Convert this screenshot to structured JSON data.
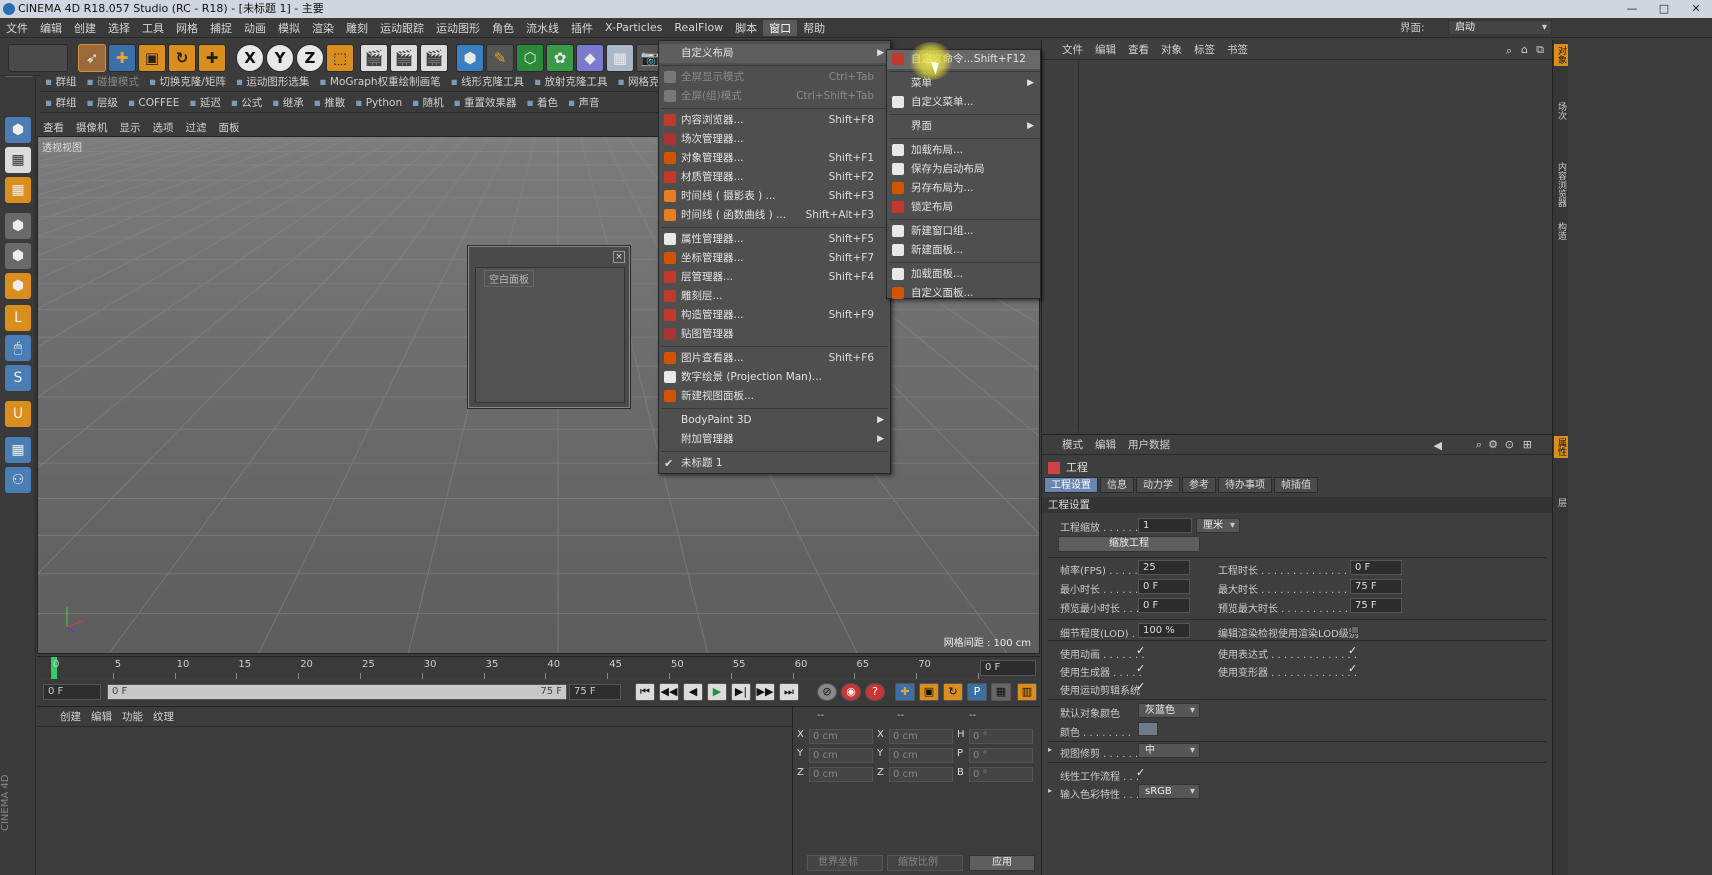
{
  "window": {
    "title": "CINEMA 4D R18.057 Studio (RC - R18) - [未标题 1] - 主要",
    "min": "—",
    "max": "□",
    "close": "✕"
  },
  "menubar": [
    "文件",
    "编辑",
    "创建",
    "选择",
    "工具",
    "网格",
    "捕捉",
    "动画",
    "模拟",
    "渲染",
    "雕刻",
    "运动跟踪",
    "运动图形",
    "角色",
    "流水线",
    "插件",
    "X-Particles",
    "RealFlow",
    "脚本",
    "窗口",
    "帮助"
  ],
  "menubar_active": "窗口",
  "layout": {
    "label": "界面:",
    "value": "启动"
  },
  "toolbar": {
    "x": "X",
    "y": "Y",
    "z": "Z"
  },
  "subbar1": [
    "群组",
    "切换克隆/矩阵",
    "运动图形选集",
    "MoGraph权重绘制画笔",
    "线形克隆工具",
    "放射克隆工具",
    "网格克隆"
  ],
  "subbar1_dim": "碰撞模式",
  "subbar2": [
    "群组",
    "层级",
    "COFFEE",
    "延迟",
    "公式",
    "继承",
    "推散",
    "Python",
    "随机",
    "重置效果器",
    "着色",
    "声音"
  ],
  "viewport": {
    "menu": [
      "查看",
      "摄像机",
      "显示",
      "选项",
      "过滤",
      "面板"
    ],
    "label": "透视视图",
    "grid": "网格间距 : 100 cm"
  },
  "floatwin": {
    "tab": "空白面板",
    "close": "×"
  },
  "timeline": {
    "ticks": [
      "0",
      "5",
      "10",
      "15",
      "20",
      "25",
      "30",
      "35",
      "40",
      "45",
      "50",
      "55",
      "60",
      "65",
      "70",
      "75"
    ],
    "frame": "0 F"
  },
  "transport": {
    "start": "0 F",
    "slider_left": "0 F",
    "slider_right": "75 F",
    "end": "75 F",
    "buttons": [
      "⏮",
      "◀◀",
      "◀",
      "▶",
      "▶|",
      "▶▶",
      "⏭"
    ]
  },
  "material": {
    "menu": [
      "创建",
      "编辑",
      "功能",
      "纹理"
    ]
  },
  "coord": {
    "headers": [
      "--",
      "--",
      "--"
    ],
    "rows": [
      {
        "a": "X",
        "av": "0 cm",
        "b": "X",
        "bv": "0 cm",
        "c": "H",
        "cv": "0 °"
      },
      {
        "a": "Y",
        "av": "0 cm",
        "b": "Y",
        "bv": "0 cm",
        "c": "P",
        "cv": "0 °"
      },
      {
        "a": "Z",
        "av": "0 cm",
        "b": "Z",
        "bv": "0 cm",
        "c": "B",
        "cv": "0 °"
      }
    ],
    "mode1": "世界坐标",
    "mode2": "缩放比例",
    "apply": "应用"
  },
  "objmgr": {
    "menu": [
      "文件",
      "编辑",
      "查看",
      "对象",
      "标签",
      "书签"
    ]
  },
  "attr": {
    "menu": [
      "模式",
      "编辑",
      "用户数据"
    ],
    "title": "工程",
    "tabs": [
      "工程设置",
      "信息",
      "动力学",
      "参考",
      "待办事项",
      "帧插值"
    ],
    "section": "工程设置",
    "scale_label": "工程缩放 . . . . . .",
    "scale_value": "1",
    "scale_unit": "厘米",
    "scale_button": "缩放工程",
    "fps_label": "帧率(FPS) . . . . . .",
    "fps_value": "25",
    "min_label": "最小时长 . . . . . . .",
    "min_value": "0 F",
    "prevmin_label": "预览最小时长 . . .",
    "prevmin_value": "0 F",
    "dur_label": "工程时长 . . . . . . . . . . . . . . . .",
    "dur_value": "0 F",
    "max_label": "最大时长 . . . . . . . . . . . . . . . .",
    "max_value": "75 F",
    "prevmax_label": "预览最大时长 . . . . . . . . . . . .",
    "prevmax_value": "75 F",
    "lod_label": "细节程度(LOD) . . .",
    "lod_value": "100 %",
    "lod_check_label": "编辑渲染检视使用渲染LOD级别",
    "anim_label": "使用动画 . . . . . . .",
    "gen_label": "使用生成器 . . . . .",
    "motion_label": "使用运动剪辑系统",
    "expr_label": "使用表达式 . . . . . . . . . . . . . .",
    "deform_label": "使用变形器 . . . . . . . . . . . . . .",
    "check": "✓",
    "defcolor_label": "默认对象颜色",
    "defcolor_value": "灰蓝色",
    "color_label": "颜色 . . . . . . . .",
    "clip_label": "视图修剪 . . . . . . .",
    "clip_value": "中",
    "linear_label": "线性工作流程 . . .",
    "input_label": "输入色彩特性 . . .",
    "input_value": "sRGB"
  },
  "right_tabs": [
    "对象",
    "场次",
    "内容浏览器",
    "构造",
    "属性",
    "层"
  ],
  "window_menu": {
    "items": [
      {
        "label": "自定义布局",
        "sc": "",
        "arrow": true,
        "hl": true,
        "dim": false,
        "icon": ""
      },
      {
        "label": "全屏显示模式",
        "sc": "Ctrl+Tab",
        "dim": true,
        "icon": "#777"
      },
      {
        "label": "全屏(组)模式",
        "sc": "Ctrl+Shift+Tab",
        "dim": true,
        "icon": "#777"
      },
      {
        "label": "内容浏览器...",
        "sc": "Shift+F8",
        "icon": "#c0392b"
      },
      {
        "label": "场次管理器...",
        "sc": "",
        "icon": "#a33"
      },
      {
        "label": "对象管理器...",
        "sc": "Shift+F1",
        "icon": "#d35400"
      },
      {
        "label": "材质管理器...",
        "sc": "Shift+F2",
        "icon": "#c0392b"
      },
      {
        "label": "时间线 ( 摄影表 ) ...",
        "sc": "Shift+F3",
        "icon": "#e67e22"
      },
      {
        "label": "时间线 ( 函数曲线 ) ...",
        "sc": "Shift+Alt+F3",
        "icon": "#e67e22"
      },
      {
        "label": "属性管理器...",
        "sc": "Shift+F5",
        "icon": "#e8e8e8"
      },
      {
        "label": "坐标管理器...",
        "sc": "Shift+F7",
        "icon": "#d35400"
      },
      {
        "label": "层管理器...",
        "sc": "Shift+F4",
        "icon": "#c0392b"
      },
      {
        "label": "雕刻层...",
        "sc": "",
        "icon": "#c0392b"
      },
      {
        "label": "构造管理器...",
        "sc": "Shift+F9",
        "icon": "#c0392b"
      },
      {
        "label": "贴图管理器",
        "sc": "",
        "icon": "#a33"
      },
      {
        "label": "图片查看器...",
        "sc": "Shift+F6",
        "icon": "#d35400"
      },
      {
        "label": "数字绘景 (Projection Man)...",
        "sc": "",
        "icon": "#e8e8e8"
      },
      {
        "label": "新建视图面板...",
        "sc": "",
        "icon": "#d35400"
      },
      {
        "label": "BodyPaint 3D",
        "sc": "",
        "arrow": true,
        "icon": ""
      },
      {
        "label": "附加管理器",
        "sc": "",
        "arrow": true,
        "icon": ""
      },
      {
        "label": "未标题 1",
        "sc": "",
        "icon": "",
        "check": true
      }
    ]
  },
  "layout_submenu": {
    "items": [
      {
        "label": "自定义命令...",
        "sc": "Shift+F12",
        "hl": true,
        "icon": "#c0392b"
      },
      {
        "label": "菜单",
        "sc": "",
        "arrow": true,
        "icon": ""
      },
      {
        "label": "自定义菜单...",
        "sc": "",
        "icon": "#e8e8e8"
      },
      {
        "label": "界面",
        "sc": "",
        "arrow": true,
        "icon": ""
      },
      {
        "label": "加载布局...",
        "sc": "",
        "icon": "#e8e8e8"
      },
      {
        "label": "保存为启动布局",
        "sc": "",
        "icon": "#e8e8e8"
      },
      {
        "label": "另存布局为...",
        "sc": "",
        "icon": "#d35400"
      },
      {
        "label": "锁定布局",
        "sc": "",
        "icon": "#c0392b"
      },
      {
        "label": "新建窗口组...",
        "sc": "",
        "icon": "#e8e8e8"
      },
      {
        "label": "新建面板...",
        "sc": "",
        "icon": "#e8e8e8"
      },
      {
        "label": "加载面板...",
        "sc": "",
        "icon": "#e8e8e8"
      },
      {
        "label": "自定义面板...",
        "sc": "",
        "icon": "#d35400"
      }
    ]
  },
  "watermark": "CINEMA 4D"
}
